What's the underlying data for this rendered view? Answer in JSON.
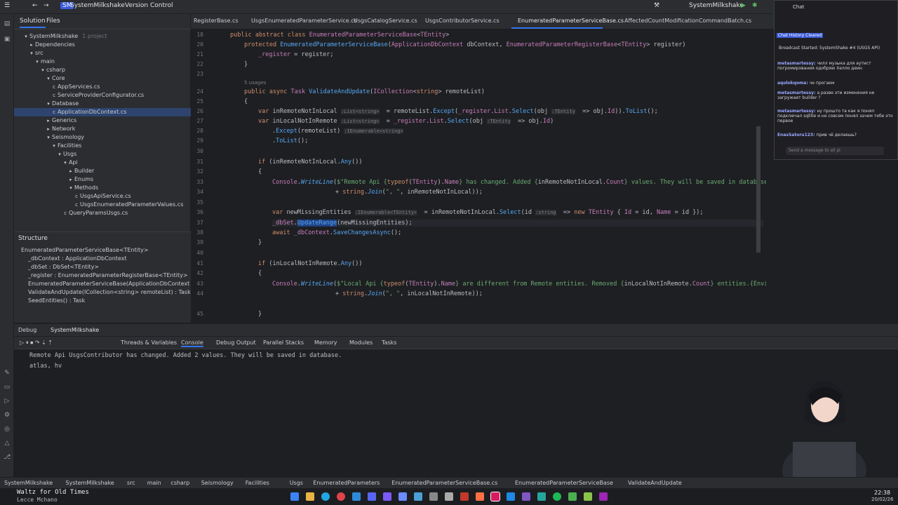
{
  "titlebar": {
    "project": "SystemMilkshake",
    "vcs": "Version Control",
    "run_config": "SystemMilkshake"
  },
  "solution": {
    "tab_solution": "Solution",
    "tab_files": "Files",
    "root": "SystemMilkshake",
    "root_note": "1 project",
    "items": [
      "SystemMilkshake",
      "Dependencies",
      "src",
      "main",
      "csharp",
      "Core",
      "AppServices.cs",
      "ServiceProviderConfigurator.cs",
      "Database",
      "ApplicationDbContext.cs",
      "Generics",
      "Network",
      "Seismology",
      "Facilities",
      "Usgs",
      "Api",
      "Builder",
      "Enums",
      "Methods",
      "UsgsApiService.cs",
      "UsgsEnumeratedParameterValues.cs",
      "QueryParamsUsgs.cs"
    ]
  },
  "structure": {
    "title": "Structure",
    "items": [
      "EnumeratedParameterServiceBase<TEntity>",
      "_dbContext : ApplicationDbContext",
      "_dbSet : DbSet<TEntity>",
      "_register : EnumeratedParameterRegisterBase<TEntity>",
      "EnumeratedParameterServiceBase(ApplicationDbContext dbConte",
      "ValidateAndUpdate(ICollection<string> remoteList) : Task",
      "SeedEntities() : Task"
    ]
  },
  "tabs": [
    "RegisterBase.cs",
    "UsgsEnumeratedParameterService.cs",
    "UsgsCatalogService.cs",
    "UsgsContributorService.cs",
    "EnumeratedParameterServiceBase.cs",
    "AffectedCountModificationCommandBatch.cs"
  ],
  "gutter": [
    "18",
    "20",
    "21",
    "22",
    "23",
    "24",
    "25",
    "26",
    "27",
    "28",
    "29",
    "30",
    "31",
    "32",
    "33",
    "34",
    "35",
    "36",
    "37",
    "38",
    "39",
    "40",
    "41",
    "42",
    "43",
    "44",
    "45"
  ],
  "usages": "5 usages",
  "chat": {
    "title": "Chat",
    "cleared": "Chat History Cleared",
    "placeholder": "Send a message to all pl",
    "messages": [
      {
        "user": "",
        "text": "Broadcast Started: SystemShake #4 (USGS API)"
      },
      {
        "user": "metasmartessy:",
        "text": "чилл музыка для аутист погромирования одобряю Хелло деин"
      },
      {
        "user": "aqolokqoma:",
        "text": "че прогаем"
      },
      {
        "user": "metasmartessy:",
        "text": "а разве эти изменения не загружает builder ?"
      },
      {
        "user": "metasmartessy:",
        "text": "ну прошто та как я понял подключал sqllite и не совсем понял зачем тебе это первое"
      },
      {
        "user": "EnasSatoru123:",
        "text": "прив чё делаешь?"
      }
    ]
  },
  "debug": {
    "tab": "Debug",
    "session": "SystemMilkshake",
    "tools": [
      "Threads & Variables",
      "Console",
      "Debug Output",
      "Parallel Stacks",
      "Memory",
      "Modules",
      "Tasks"
    ],
    "lines": [
      "Remote Api UsgsContributor has changed. Added 2 values. They will be saved in database.",
      "atlas, hv"
    ]
  },
  "breadcrumb": [
    "SystemMilkshake",
    "SystemMilkshake",
    "src",
    "main",
    "csharp",
    "Seismology",
    "Facilities",
    "Usgs",
    "EnumeratedParameters",
    "EnumeratedParameterServiceBase.cs",
    "EnumeratedParameterServiceBase",
    "ValidateAndUpdate"
  ],
  "music": {
    "song": "Waltz for Old Times",
    "artist": "Lecce Mchano"
  },
  "clock": {
    "time": "22:38",
    "date": "20/02/26"
  }
}
